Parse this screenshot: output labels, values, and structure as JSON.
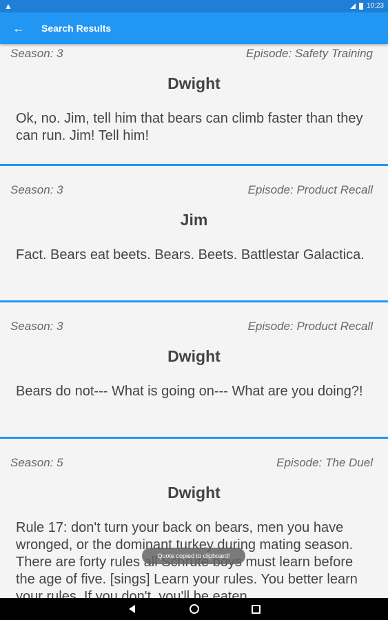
{
  "status_bar": {
    "time": "10:23",
    "warning_icon": "warning-icon",
    "signal_icon": "signal-icon",
    "battery_icon": "battery-icon"
  },
  "app_bar": {
    "back_icon": "arrow-back-icon",
    "title": "Search Results"
  },
  "results": [
    {
      "season": "Season: 3",
      "episode": "Episode: Safety Training",
      "speaker": "Dwight",
      "quote": "Ok, no. Jim, tell him that bears can climb faster than they can run. Jim! Tell him!"
    },
    {
      "season": "Season: 3",
      "episode": "Episode: Product Recall",
      "speaker": "Jim",
      "quote": "Fact. Bears eat beets. Bears. Beets. Battlestar Galactica."
    },
    {
      "season": "Season: 3",
      "episode": "Episode: Product Recall",
      "speaker": "Dwight",
      "quote": "Bears do not--- What is going on--- What are you doing?!"
    },
    {
      "season": "Season: 5",
      "episode": "Episode: The Duel",
      "speaker": "Dwight",
      "quote": "Rule 17: don't turn your back on bears, men you have wronged, or the dominant turkey during mating season. There are forty rules all Schrute boys must learn before the age of five. [sings] Learn your rules. You better learn your rules. If you don't, you'll be eaten"
    }
  ],
  "toast": {
    "message": "Quote copied to clipboard!"
  },
  "nav_bar": {
    "back_icon": "nav-back-icon",
    "home_icon": "nav-home-icon",
    "recents_icon": "nav-recents-icon"
  },
  "colors": {
    "accent": "#2196f3",
    "status_bar": "#1f7fd6",
    "card_background": "#f4f4f4",
    "text": "#444444",
    "meta_text": "#666666"
  }
}
